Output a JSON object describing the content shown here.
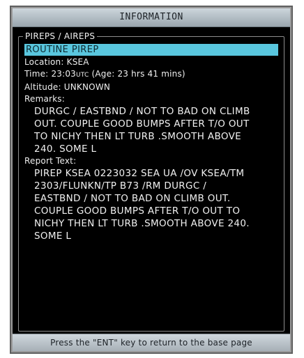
{
  "window": {
    "title": "INFORMATION"
  },
  "group": {
    "label": "PIREPS / AIREPS"
  },
  "report": {
    "type": "ROUTINE PIREP",
    "location_label": "Location:",
    "location_value": "KSEA",
    "time_label": "Time:",
    "time_value": "23:03",
    "time_unit": "UTC",
    "age_text": "(Age: 23 hrs 41 mins)",
    "altitude_label": "Altitude:",
    "altitude_value": "UNKNOWN",
    "remarks_label": "Remarks:",
    "remarks_lines": [
      "DURGC / EASTBND / NOT TO BAD ON CLIMB",
      "OUT. COUPLE GOOD BUMPS AFTER T/O OUT",
      "TO NICHY THEN LT TURB .SMOOTH ABOVE",
      "240. SOME L"
    ],
    "report_text_label": "Report Text:",
    "report_text_lines": [
      "PIREP KSEA 0223032 SEA UA /OV KSEA/TM",
      "2303/FLUNKN/TP B73 /RM DURGC /",
      "EASTBND / NOT TO BAD ON CLIMB OUT.",
      "COUPLE GOOD BUMPS AFTER T/O OUT TO",
      "NICHY THEN LT TURB .SMOOTH ABOVE 240.",
      "SOME L"
    ]
  },
  "footer": {
    "text": "Press the \"ENT\" key to return to the base page"
  },
  "colors": {
    "screen_background": "#000000",
    "text": "#f0f0f0",
    "highlight": "#59c6de",
    "title_bar": "#b8c3ca"
  }
}
